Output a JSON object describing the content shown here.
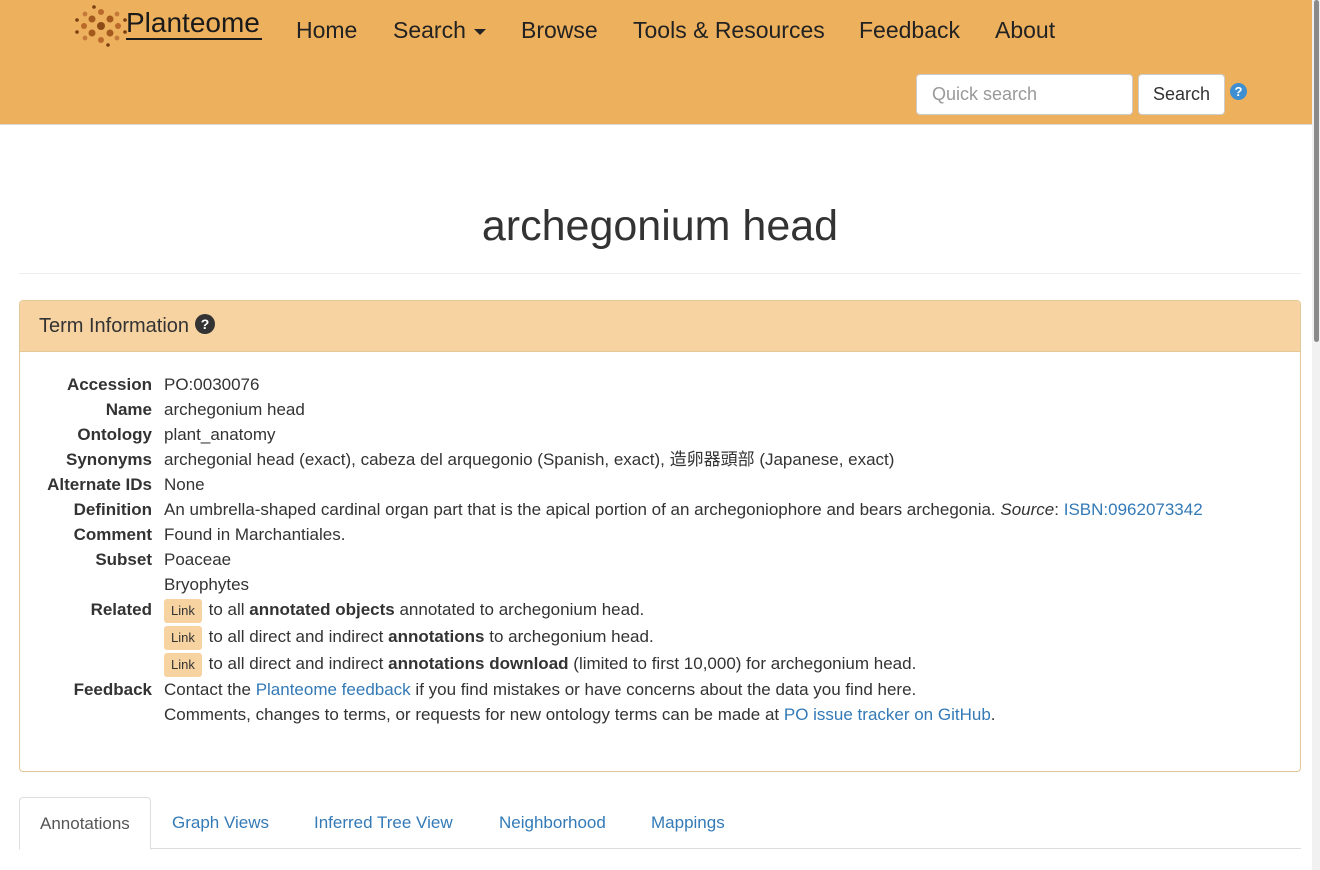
{
  "brand": {
    "name": "Planteome"
  },
  "nav": {
    "home": "Home",
    "search": "Search",
    "browse": "Browse",
    "tools": "Tools & Resources",
    "feedback": "Feedback",
    "about": "About"
  },
  "quick_search": {
    "placeholder": "Quick search",
    "button": "Search",
    "help": "?"
  },
  "page": {
    "title": "archegonium head"
  },
  "panel": {
    "title": "Term Information"
  },
  "term": {
    "accession_label": "Accession",
    "accession": "PO:0030076",
    "name_label": "Name",
    "name": "archegonium head",
    "ontology_label": "Ontology",
    "ontology": "plant_anatomy",
    "synonyms_label": "Synonyms",
    "synonyms": "archegonial head (exact), cabeza del arquegonio (Spanish, exact), 造卵器頭部 (Japanese, exact)",
    "alt_ids_label": "Alternate IDs",
    "alt_ids": "None",
    "definition_label": "Definition",
    "definition": "An umbrella-shaped cardinal organ part that is the apical portion of an archegoniophore and bears archegonia.",
    "source_label": "Source",
    "source_link": "ISBN:0962073342",
    "comment_label": "Comment",
    "comment": "Found in Marchantiales.",
    "subset_label": "Subset",
    "subsets": [
      "Poaceae",
      "Bryophytes"
    ],
    "related_label": "Related",
    "related": [
      {
        "button": "Link",
        "pre": "to all",
        "bold": "annotated objects",
        "post": "annotated to archegonium head."
      },
      {
        "button": "Link",
        "pre": "to all direct and indirect",
        "bold": "annotations",
        "post": "to archegonium head."
      },
      {
        "button": "Link",
        "pre": "to all direct and indirect",
        "bold": "annotations download",
        "post": "(limited to first 10,000) for archegonium head."
      }
    ],
    "feedback_label": "Feedback",
    "feedback_line1_pre": "Contact the",
    "feedback_line1_link": "Planteome feedback",
    "feedback_line1_post": "if you find mistakes or have concerns about the data you find here.",
    "feedback_line2_pre": "Comments, changes to terms, or requests for new ontology terms can be made at",
    "feedback_line2_link": "PO issue tracker on GitHub",
    "feedback_line2_post": "."
  },
  "tabs": [
    "Annotations",
    "Graph Views",
    "Inferred Tree View",
    "Neighborhood",
    "Mappings"
  ],
  "colors": {
    "navbar": "#edb05d",
    "panel_heading": "#f7d3a2",
    "link": "#337ab7"
  }
}
